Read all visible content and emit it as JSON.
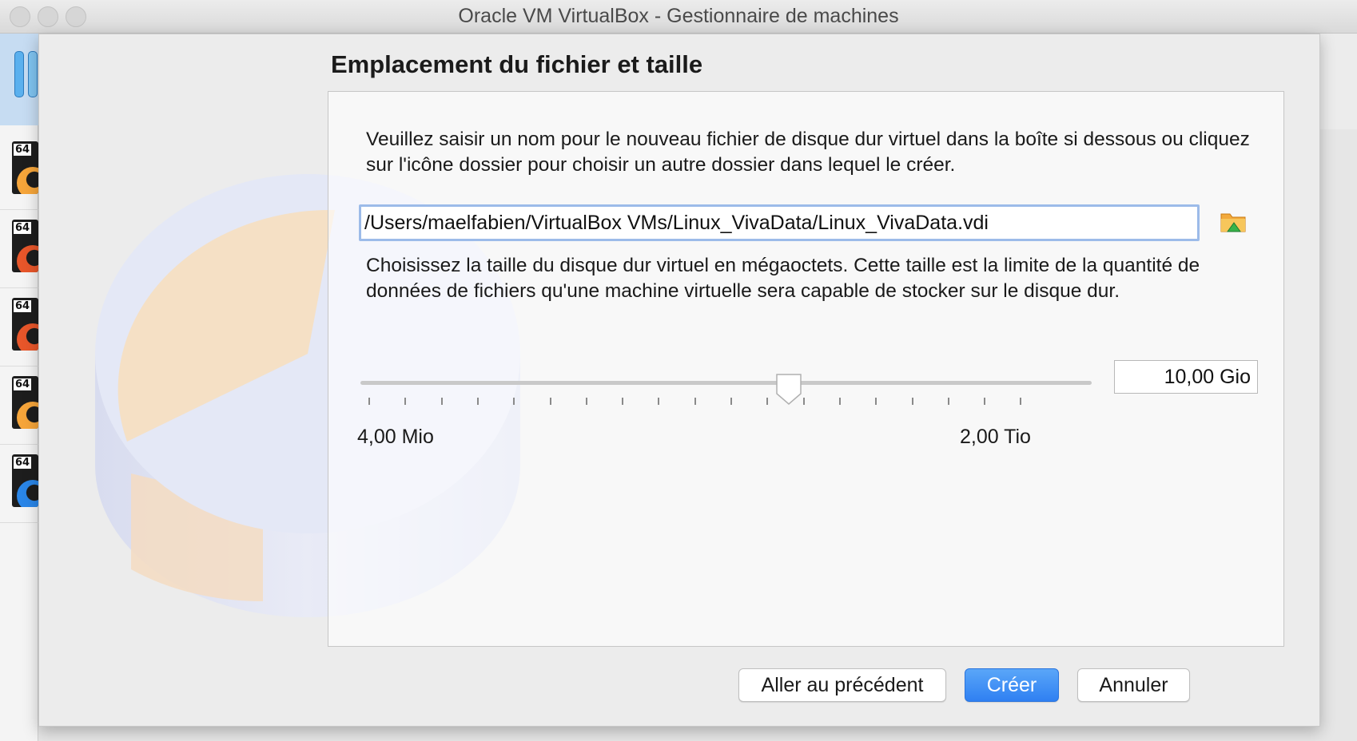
{
  "window": {
    "title": "Oracle VM VirtualBox - Gestionnaire de machines"
  },
  "vm_list": {
    "badges": [
      "64",
      "64",
      "64",
      "64",
      "64"
    ]
  },
  "wizard": {
    "title": "Emplacement du fichier et taille",
    "file_description": "Veuillez saisir un nom pour le nouveau fichier de disque dur virtuel dans la boîte si dessous ou cliquez sur l'icône dossier pour choisir un autre dossier dans lequel le créer.",
    "file_path": "/Users/maelfabien/VirtualBox VMs/Linux_VivaData/Linux_VivaData.vdi",
    "size_description": "Choisissez la taille du disque dur virtuel en mégaoctets. Cette taille est la limite de la quantité de données de fichiers qu'une machine virtuelle sera capable de stocker sur le disque dur.",
    "slider": {
      "min_label": "4,00 Mio",
      "max_label": "2,00 Tio",
      "position": 0.586
    },
    "size_value": "10,00 Gio",
    "buttons": {
      "back": "Aller au précédent",
      "create": "Créer",
      "cancel": "Annuler"
    }
  },
  "colors": {
    "primary_button": "#2f80f2",
    "focus_ring": "#9cbbe9",
    "selection": "#c6dcf2"
  },
  "icons": {
    "folder": "folder-open-icon",
    "tools": "tools-icon",
    "os": "os-icon"
  }
}
